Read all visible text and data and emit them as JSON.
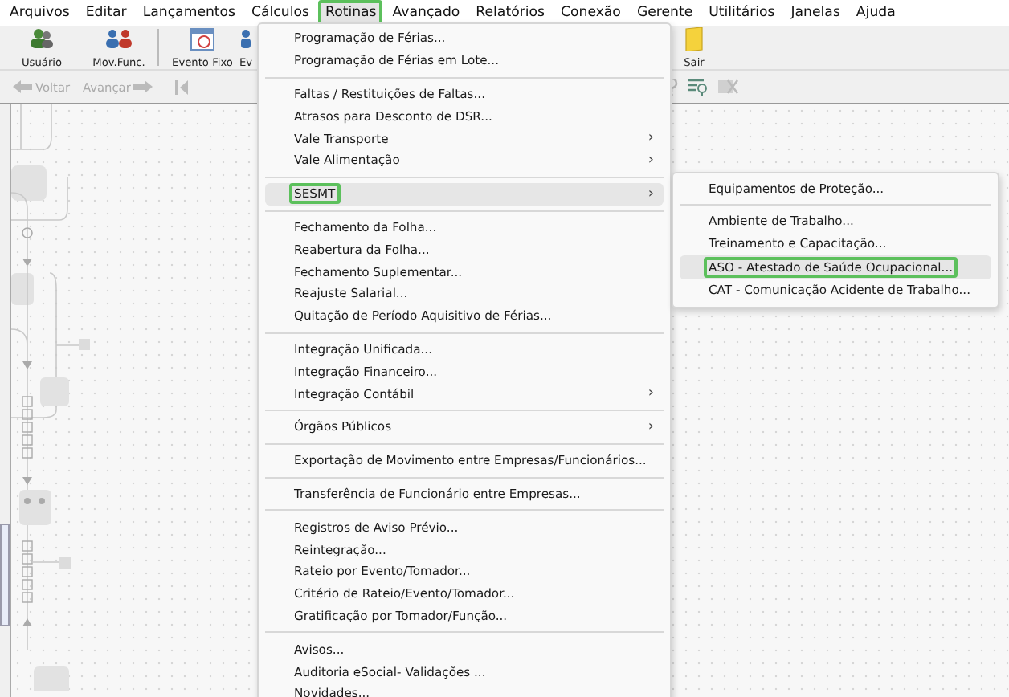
{
  "menubar": [
    {
      "label": "Arquivos",
      "open": false
    },
    {
      "label": "Editar",
      "open": false
    },
    {
      "label": "Lançamentos",
      "open": false
    },
    {
      "label": "Cálculos",
      "open": false
    },
    {
      "label": "Rotinas",
      "open": true,
      "marked": true
    },
    {
      "label": "Avançado",
      "open": false
    },
    {
      "label": "Relatórios",
      "open": false
    },
    {
      "label": "Conexão",
      "open": false
    },
    {
      "label": "Gerente",
      "open": false
    },
    {
      "label": "Utilitários",
      "open": false
    },
    {
      "label": "Janelas",
      "open": false
    },
    {
      "label": "Ajuda",
      "open": false
    }
  ],
  "toolbar": [
    {
      "kind": "users",
      "label": "Usuário"
    },
    {
      "kind": "transfer",
      "label": "Mov.Func."
    },
    {
      "kind": "calendar",
      "label": "Evento Fixo"
    },
    {
      "kind": "partial",
      "label": "Ev"
    },
    {
      "kind": "exit",
      "label": "Sair"
    }
  ],
  "nav": {
    "back": "Voltar",
    "forward": "Avançar"
  },
  "menu": [
    {
      "kind": "item",
      "label": "Programação de Férias...",
      "selected": false
    },
    {
      "kind": "item",
      "label": "Programação de Férias em  Lote...",
      "selected": false
    },
    {
      "kind": "separator"
    },
    {
      "kind": "item",
      "label": "Faltas / Restituições de Faltas...",
      "selected": false
    },
    {
      "kind": "item",
      "label": "Atrasos para Desconto de DSR...",
      "selected": false
    },
    {
      "kind": "item",
      "label": "Vale Transporte",
      "arrow": "›",
      "selected": false
    },
    {
      "kind": "item",
      "label": "Vale Alimentação",
      "arrow": "›",
      "selected": false
    },
    {
      "kind": "separator"
    },
    {
      "kind": "item",
      "label": "SESMT",
      "arrow": "›",
      "selected": true,
      "marked": true
    },
    {
      "kind": "separator"
    },
    {
      "kind": "item",
      "label": "Fechamento da Folha...",
      "selected": false
    },
    {
      "kind": "item",
      "label": "Reabertura da Folha...",
      "selected": false
    },
    {
      "kind": "item",
      "label": "Fechamento Suplementar...",
      "selected": false
    },
    {
      "kind": "item",
      "label": "Reajuste Salarial...",
      "selected": false
    },
    {
      "kind": "item",
      "label": "Quitação de Período Aquisitivo de Férias...",
      "selected": false
    },
    {
      "kind": "separator"
    },
    {
      "kind": "item",
      "label": "Integração Unificada...",
      "selected": false
    },
    {
      "kind": "item",
      "label": "Integração Financeiro...",
      "selected": false
    },
    {
      "kind": "item",
      "label": "Integração Contábil",
      "arrow": "›",
      "selected": false
    },
    {
      "kind": "separator"
    },
    {
      "kind": "item",
      "label": "Órgãos Públicos",
      "arrow": "›",
      "selected": false
    },
    {
      "kind": "separator"
    },
    {
      "kind": "item",
      "label": "Exportação de Movimento entre Empresas/Funcionários...",
      "selected": false
    },
    {
      "kind": "separator"
    },
    {
      "kind": "item",
      "label": "Transferência de Funcionário entre Empresas...",
      "selected": false
    },
    {
      "kind": "separator"
    },
    {
      "kind": "item",
      "label": "Registros de Aviso Prévio...",
      "selected": false
    },
    {
      "kind": "item",
      "label": "Reintegração...",
      "selected": false
    },
    {
      "kind": "item",
      "label": "Rateio por Evento/Tomador...",
      "selected": false
    },
    {
      "kind": "item",
      "label": "Critério de Rateio/Evento/Tomador...",
      "selected": false
    },
    {
      "kind": "item",
      "label": "Gratificação por Tomador/Função...",
      "selected": false
    },
    {
      "kind": "separator"
    },
    {
      "kind": "item",
      "label": "Avisos...",
      "selected": false
    },
    {
      "kind": "item",
      "label": "Auditoria eSocial- Validações ...",
      "selected": false
    },
    {
      "kind": "item",
      "label": "Novidades...",
      "selected": false
    }
  ],
  "submenu": [
    {
      "kind": "item",
      "label": "Equipamentos de Proteção...",
      "selected": false
    },
    {
      "kind": "separator"
    },
    {
      "kind": "item",
      "label": "Ambiente de Trabalho...",
      "selected": false
    },
    {
      "kind": "item",
      "label": "Treinamento e Capacitação...",
      "selected": false
    },
    {
      "kind": "item",
      "label": "ASO - Atestado de Saúde Ocupacional...",
      "selected": true,
      "marked": true
    },
    {
      "kind": "item",
      "label": "CAT - Comunicação Acidente de Trabalho...",
      "selected": false
    }
  ]
}
